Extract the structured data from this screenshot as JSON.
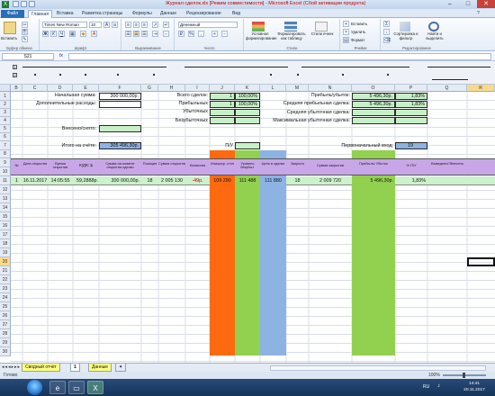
{
  "window": {
    "title": "Журнал сделок.xls [Режим совместимости] - Microsoft Excel (Сбой активации продукта)"
  },
  "tabs": [
    "Файл",
    "Главная",
    "Вставка",
    "Разметка страницы",
    "Формулы",
    "Данные",
    "Рецензирование",
    "Вид"
  ],
  "ribbon": {
    "paste_label": "Вставить",
    "font_name": "Times New Roman",
    "font_size": "10",
    "number_format": "Денежный",
    "cond_format": "Условное форматирование",
    "format_table": "Форматировать как таблицу",
    "cell_styles": "Стили ячеек",
    "insert": "Вставить",
    "delete": "Удалить",
    "format": "Формат",
    "sort": "Сортировка и фильтр",
    "find": "Найти и выделить",
    "groups": [
      "Буфер обмена",
      "Шрифт",
      "Выравнивание",
      "Число",
      "Стили",
      "Ячейки",
      "Редактирование"
    ]
  },
  "formula_bar": {
    "name_box": "S21",
    "fx": "fx",
    "value": ""
  },
  "columns": [
    "B",
    "C",
    "D",
    "E",
    "F",
    "G",
    "H",
    "I",
    "J",
    "K",
    "L",
    "M",
    "N",
    "O",
    "P",
    "Q",
    "R",
    "S"
  ],
  "summary": {
    "start_label": "Начальная сумма:",
    "start_value": "300 000,00р.",
    "extra_label": "Дополнительные расходы:",
    "extra_value": "",
    "deposit_label": "Внесено/снято:",
    "deposit_value": "",
    "total_label": "Итого на счёте:",
    "total_value": "305 496,30р.",
    "deals_label": "Всего сделок:",
    "deals_count": "1",
    "deals_pct": "100,00%",
    "profit_deals_label": "Прибыльных",
    "profit_count": "1",
    "profit_pct": "100,00%",
    "loss_deals_label": "Убыточных",
    "breakeven_label": "Безубыточных",
    "pu_label": "П/У",
    "pl_label": "Прибыль/убыток:",
    "pl_value": "5 496,30р.",
    "pl_pct": "1,83%",
    "avg_profit_label": "Средняя прибыльная сделка:",
    "avg_profit_value": "5 496,30р.",
    "avg_profit_pct": "1,83%",
    "avg_loss_label": "Средняя убыточная сделка:",
    "max_loss_label": "Максимальная убыточная сделка:",
    "first_entry_label": "Первоначальный вход:",
    "first_entry_value": "19"
  },
  "table_headers": [
    "№",
    "Дата открытия",
    "Время открытия",
    "Курс $",
    "Сумма на момент открытия сделки",
    "Позиция",
    "Сумма открытия",
    "Комиссия",
    "Инициир. стоп",
    "Уровень безубыт.",
    "Цель в сделке",
    "Закрыто",
    "Сумма закрытия",
    "Прибыль/ Убыток",
    "% П/У",
    "Выведено/ Внесено"
  ],
  "rows": [
    {
      "n": "1",
      "date": "16.11.2017",
      "time": "14:05:55",
      "rate": "59,2888р.",
      "amount": "300 000,00р.",
      "pos": "18",
      "open_sum": "2 005 130",
      "fee": "-49р.",
      "stop": "109 290",
      "be": "111 488",
      "target": "111 880",
      "closed": "18",
      "close_sum": "2 009 720",
      "pl": "5 496,30р.",
      "pl_pct": "1,83%",
      "out": ""
    }
  ],
  "row_numbers": [
    "1",
    "2",
    "3",
    "4",
    "5",
    "6",
    "7",
    "8",
    "9",
    "10",
    "11",
    "12",
    "13",
    "14",
    "15",
    "16",
    "17",
    "18",
    "19",
    "20",
    "21",
    "22",
    "23",
    "24",
    "25",
    "26",
    "27",
    "28",
    "29",
    "30"
  ],
  "sheets": [
    "Сводный отчёт",
    "1",
    "Данные"
  ],
  "status": {
    "ready": "Готово",
    "zoom": "100%"
  },
  "taskbar": {
    "lang": "RU",
    "time": "14:41",
    "date": "20.11.2017"
  },
  "colors": {
    "orange": "#ff6a10",
    "green": "#92d050",
    "blue": "#8db3e2",
    "light_green": "#ccf2cc",
    "header_purple": "#c9a6e8"
  }
}
